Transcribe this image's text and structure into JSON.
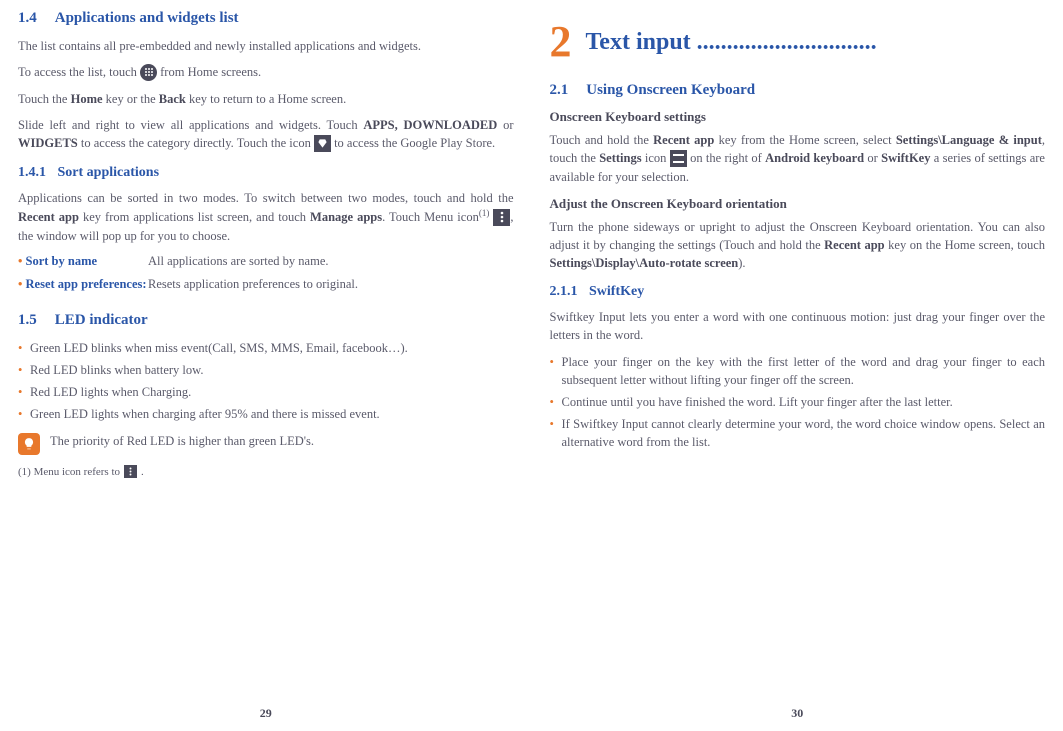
{
  "left": {
    "sec14": {
      "num": "1.4",
      "title": "Applications and widgets list"
    },
    "p1": "The list contains all pre-embedded and newly installed applications and widgets.",
    "p2a": "To access the list, touch ",
    "p2b": " from Home screens.",
    "p3a": "Touch the ",
    "p3b": "Home",
    "p3c": " key or the ",
    "p3d": "Back",
    "p3e": " key to return to a Home screen.",
    "p4a": "Slide left and right to view all applications and widgets. Touch ",
    "p4b": "APPS, DOWNLOADED",
    "p4c": " or ",
    "p4d": "WIDGETS",
    "p4e": " to access the category directly. Touch the icon ",
    "p4f": " to access the Google Play Store.",
    "sec141": {
      "num": "1.4.1",
      "title": "Sort applications"
    },
    "p5a": "Applications can be sorted in two modes. To switch between two modes, touch and hold the ",
    "p5b": "Recent app",
    "p5c": " key from applications list screen, and touch ",
    "p5d": "Manage apps",
    "p5e": ". Touch Menu icon",
    "p5sup": "(1)",
    "p5f": ", the window will pop up for you to choose.",
    "def1": {
      "label": "Sort by name",
      "value": "All applications are sorted by name."
    },
    "def2": {
      "label": "Reset app preferences:",
      "value": "Resets application preferences to original."
    },
    "sec15": {
      "num": "1.5",
      "title": "LED indicator"
    },
    "li1": "Green LED blinks when miss event(Call, SMS, MMS, Email, facebook…).",
    "li2": "Red LED blinks when battery low.",
    "li3": "Red LED lights when Charging.",
    "li4": "Green LED lights when charging after 95% and there is missed event.",
    "note": "The priority of Red LED is higher than green LED's.",
    "fn": "(1) Menu icon refers to ",
    "pagenum": "29"
  },
  "right": {
    "chapter": {
      "num": "2",
      "title": "Text input .............................."
    },
    "sec21": {
      "num": "2.1",
      "title": "Using Onscreen Keyboard"
    },
    "h4a": "Onscreen Keyboard settings",
    "p1a": "Touch and hold the ",
    "p1b": "Recent app",
    "p1c": " key from the Home screen, select ",
    "p1d": "Settings\\Language & input",
    "p1e": ", touch the ",
    "p1f": "Settings",
    "p1g": " icon ",
    "p1h": " on the right of ",
    "p1i": "Android keyboard",
    "p1j": " or ",
    "p1k": "SwiftKey",
    "p1l": " a series of settings are available for your selection.",
    "h4b": "Adjust the Onscreen Keyboard orientation",
    "p2a": "Turn the phone sideways or upright to adjust the Onscreen Keyboard orientation. You can also adjust it by changing the settings (Touch and hold the ",
    "p2b": "Recent app",
    "p2c": " key on the Home screen, touch ",
    "p2d": "Settings\\Display\\Auto-rotate screen",
    "p2e": ").",
    "sec211": {
      "num": "2.1.1",
      "title": "SwiftKey"
    },
    "p3": "Swiftkey Input lets you enter a word with one continuous motion: just drag your finger over the letters in the word.",
    "li1": "Place your finger on the key with the first letter of the word and drag your finger to each subsequent letter without lifting your finger off the screen.",
    "li2": "Continue until you have finished the word. Lift your finger after the last letter.",
    "li3": "If Swiftkey Input cannot clearly determine your word, the word choice window opens. Select an alternative word from the list.",
    "pagenum": "30"
  }
}
